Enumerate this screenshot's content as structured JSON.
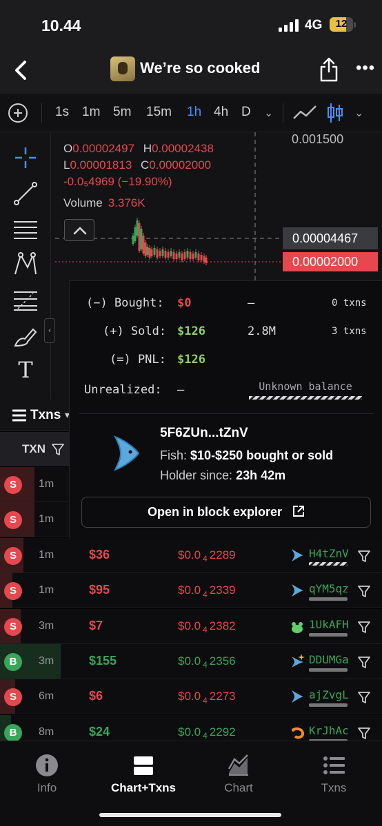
{
  "status_bar": {
    "time": "10.44",
    "network": "4G",
    "battery": "12"
  },
  "header": {
    "title": "We’re so cooked"
  },
  "timeframes": {
    "items": [
      {
        "label": "1s",
        "active": false
      },
      {
        "label": "1m",
        "active": false
      },
      {
        "label": "5m",
        "active": false
      },
      {
        "label": "15m",
        "active": false
      },
      {
        "label": "1h",
        "active": true
      },
      {
        "label": "4h",
        "active": false
      },
      {
        "label": "D",
        "active": false
      }
    ]
  },
  "chart": {
    "ohlc": {
      "o_label": "O",
      "o": "0.00002497",
      "h_label": "H",
      "h": "0.00002438",
      "l_label": "L",
      "l": "0.00001813",
      "c_label": "C",
      "c": "0.00002000",
      "change": "-0.0₅4969 (−19.90%)"
    },
    "volume_label": "Volume",
    "volume": "3.376K",
    "scale_top": "0.001500",
    "crosshair_price": "0.00004467",
    "last_price": "0.00002000"
  },
  "txns": {
    "tab_label": "Txns",
    "column_txn": "TXN",
    "rows": [
      {
        "side": "S",
        "type": "sell",
        "age": "1m",
        "usd": "",
        "price": "",
        "price_sub": "",
        "price_tail": "",
        "maker": ""
      },
      {
        "side": "S",
        "type": "sell",
        "age": "1m",
        "usd": "",
        "price": "",
        "price_sub": "",
        "price_tail": "",
        "maker": ""
      },
      {
        "side": "S",
        "type": "sell",
        "age": "1m",
        "usd": "$36",
        "price": "$0.0",
        "price_sub": "4",
        "price_tail": "2289",
        "maker": "H4tZnV",
        "maker_icon": "fish-icon"
      },
      {
        "side": "S",
        "type": "sell",
        "age": "1m",
        "usd": "$95",
        "price": "$0.0",
        "price_sub": "4",
        "price_tail": "2339",
        "maker": "qYM5qz",
        "maker_icon": "fish-icon"
      },
      {
        "side": "S",
        "type": "sell",
        "age": "3m",
        "usd": "$7",
        "price": "$0.0",
        "price_sub": "4",
        "price_tail": "2382",
        "maker": "1UkAFH",
        "maker_icon": "frog-icon"
      },
      {
        "side": "B",
        "type": "buy",
        "age": "3m",
        "usd": "$155",
        "price": "$0.0",
        "price_sub": "4",
        "price_tail": "2356",
        "maker": "DDUMGa",
        "maker_icon": "sparkle-fish-icon"
      },
      {
        "side": "S",
        "type": "sell",
        "age": "6m",
        "usd": "$6",
        "price": "$0.0",
        "price_sub": "4",
        "price_tail": "2273",
        "maker": "ajZvgL",
        "maker_icon": "fish-icon"
      },
      {
        "side": "B",
        "type": "buy",
        "age": "8m",
        "usd": "$24",
        "price": "$0.0",
        "price_sub": "4",
        "price_tail": "2292",
        "maker": "KrJhAc",
        "maker_icon": "shrimp-icon"
      }
    ]
  },
  "popup": {
    "bought_label": "(−) Bought:",
    "bought": "$0",
    "bought_amount": "—",
    "bought_txns": "0 txns",
    "sold_label": "(+) Sold:",
    "sold": "$126",
    "sold_amount": "2.8M",
    "sold_txns": "3 txns",
    "pnl_label": "(=) PNL:",
    "pnl": "$126",
    "unrealized_label": "Unrealized:",
    "unrealized": "—",
    "unknown_balance": "Unknown balance",
    "wallet": "5F6ZUn...tZnV",
    "fish_label": "Fish:",
    "fish_value": "$10-$250 bought or sold",
    "holder_label": "Holder since:",
    "holder_value": "23h 42m",
    "explorer_button": "Open in block explorer"
  },
  "bottom_nav": [
    {
      "label": "Info",
      "icon": "info-icon",
      "active": false
    },
    {
      "label": "Chart+Txns",
      "icon": "split-view-icon",
      "active": true
    },
    {
      "label": "Chart",
      "icon": "area-chart-icon",
      "active": false
    },
    {
      "label": "Txns",
      "icon": "list-icon",
      "active": false
    }
  ],
  "colors": {
    "sell": "#e5484d",
    "buy": "#3aa55a",
    "accent": "#4b8df8"
  }
}
